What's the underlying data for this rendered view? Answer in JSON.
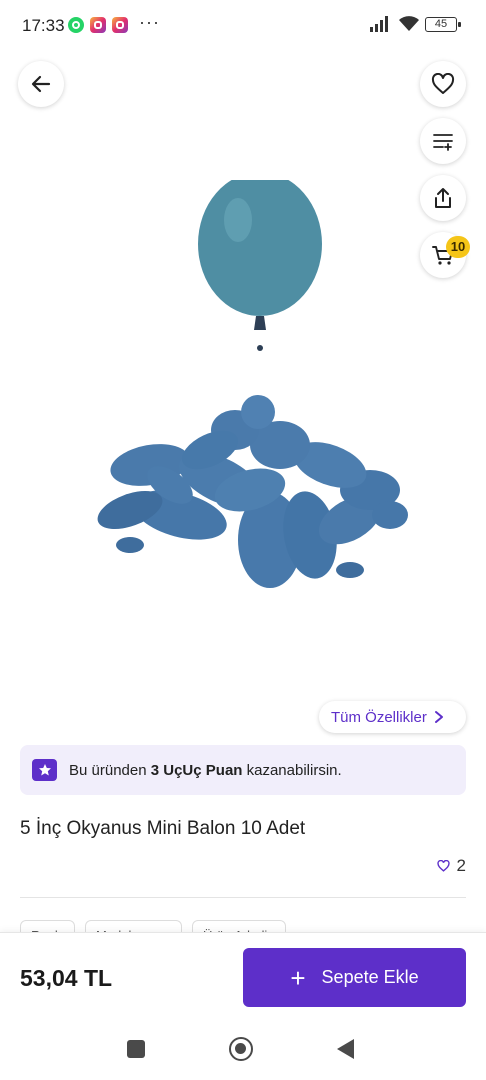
{
  "status_bar": {
    "time": "17:33",
    "more": "···",
    "battery": "45",
    "apps": [
      "whatsapp-icon",
      "instagram-icon",
      "instagram-icon"
    ]
  },
  "header_actions": {
    "back_icon": "arrow-left-icon",
    "favorite_icon": "heart-icon",
    "compare_icon": "list-add-icon",
    "share_icon": "share-icon",
    "cart_icon": "cart-icon",
    "cart_count": "10"
  },
  "product": {
    "image_description_icon": "balloon-product-image",
    "all_features_label": "Tüm Özellikler",
    "title": "5 İnç Okyanus Mini Balon 10 Adet",
    "like_count": "2"
  },
  "points_banner": {
    "prefix": "Bu üründen",
    "points": "3 UçUç Puan",
    "suffix": "kazanabilirsin."
  },
  "tags": [
    "Renk",
    "Model",
    "Ürün Adedi"
  ],
  "purchase": {
    "price": "53,04 TL",
    "add_to_cart_label": "Sepete Ekle"
  },
  "colors": {
    "accent": "#5d2fc9",
    "banner_bg": "#f1eefb",
    "badge": "#f5c518",
    "balloon": "#4c7fae",
    "balloon_top": "#4f8ea3"
  }
}
